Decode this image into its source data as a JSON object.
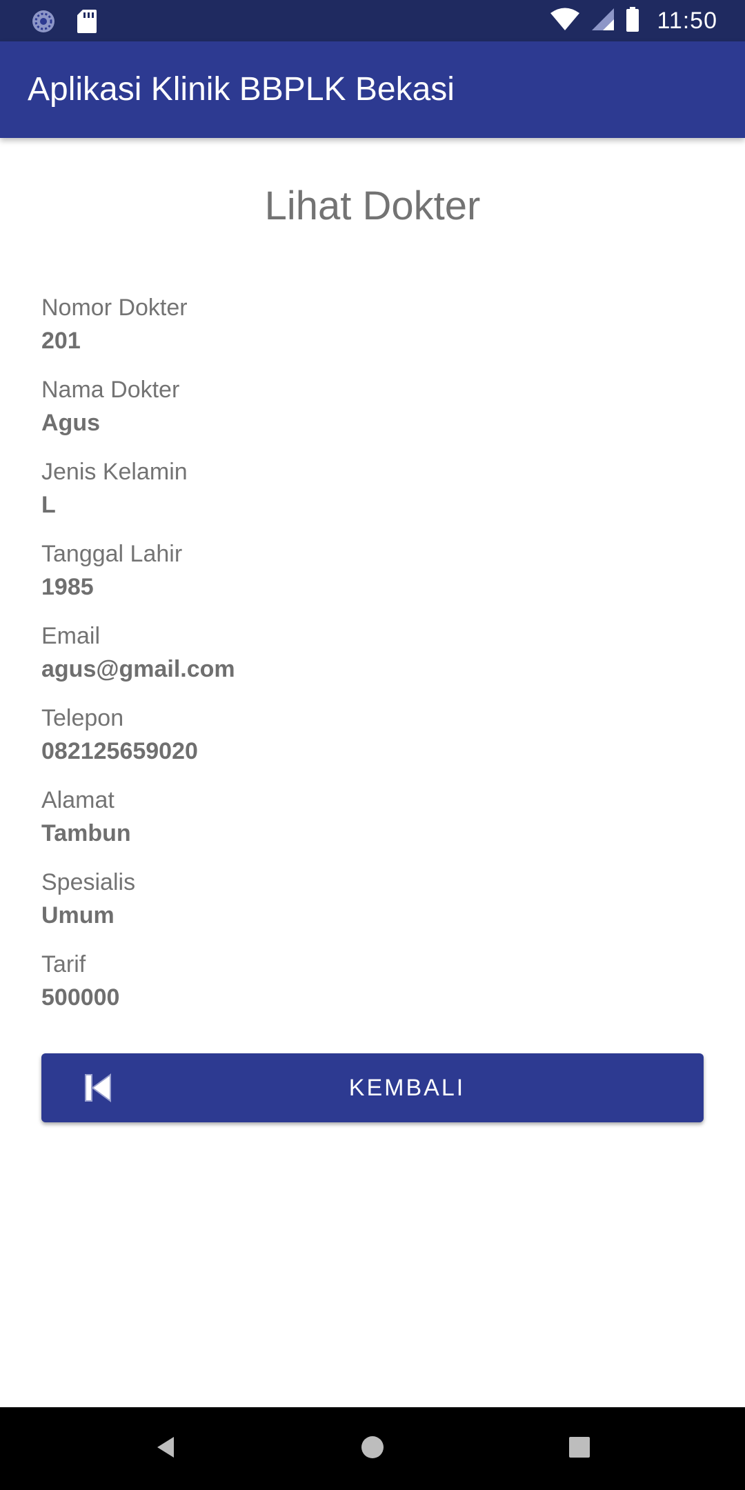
{
  "status_bar": {
    "time": "11:50",
    "icons": [
      "sync-icon",
      "sd-card-icon",
      "wifi-icon",
      "signal-icon",
      "battery-icon"
    ]
  },
  "app_bar": {
    "title": "Aplikasi Klinik BBPLK Bekasi"
  },
  "page": {
    "title": "Lihat Dokter"
  },
  "fields": [
    {
      "label": "Nomor Dokter",
      "value": "201"
    },
    {
      "label": "Nama Dokter",
      "value": "Agus"
    },
    {
      "label": "Jenis Kelamin",
      "value": "L"
    },
    {
      "label": "Tanggal Lahir",
      "value": "1985"
    },
    {
      "label": "Email",
      "value": "agus@gmail.com"
    },
    {
      "label": "Telepon",
      "value": "082125659020"
    },
    {
      "label": "Alamat",
      "value": "Tambun"
    },
    {
      "label": "Spesialis",
      "value": "Umum"
    },
    {
      "label": "Tarif",
      "value": "500000"
    }
  ],
  "back_button": {
    "label": "KEMBALI",
    "icon": "skip-previous-icon"
  },
  "nav_bar": {
    "buttons": [
      "back-icon",
      "home-icon",
      "recents-icon"
    ]
  },
  "colors": {
    "status_bar": "#1f2a60",
    "primary": "#2d3a91",
    "label_text": "#737373",
    "value_text": "#6f6f6f",
    "nav_bar": "#000000"
  }
}
